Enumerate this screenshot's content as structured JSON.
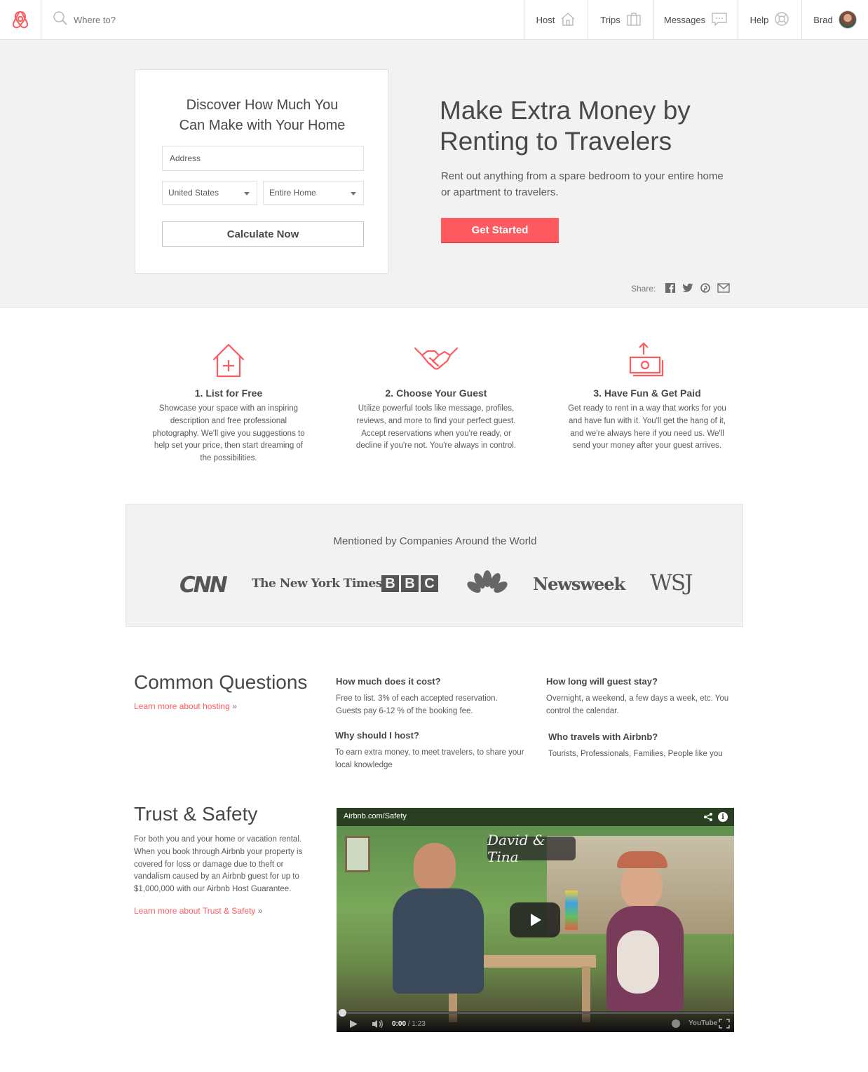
{
  "header": {
    "search_placeholder": "Where to?",
    "nav": [
      {
        "label": "Host",
        "icon": "house-icon"
      },
      {
        "label": "Trips",
        "icon": "suitcase-icon"
      },
      {
        "label": "Messages",
        "icon": "chat-bubble-icon"
      },
      {
        "label": "Help",
        "icon": "lifebuoy-icon"
      },
      {
        "label": "Brad",
        "icon": "avatar"
      }
    ]
  },
  "calculator": {
    "title_line1": "Discover How Much You",
    "title_line2": "Can Make with Your Home",
    "address_placeholder": "Address",
    "country_selected": "United States",
    "room_type_selected": "Entire Home",
    "button_label": "Calculate Now"
  },
  "hero": {
    "title_line1": "Make Extra Money by",
    "title_line2": "Renting to Travelers",
    "subtitle": "Rent out anything from a spare bedroom to your entire home or apartment to travelers.",
    "cta_label": "Get Started",
    "share_label": "Share:"
  },
  "steps": [
    {
      "title": "1. List for Free",
      "body": "Showcase your space with an inspiring description and free professional photography. We'll give you suggestions to help set your price, then start dreaming of the possibilities.",
      "icon": "house-plus-icon"
    },
    {
      "title": "2. Choose Your Guest",
      "body": "Utilize powerful tools like message, profiles, reviews, and more to find your perfect guest. Accept reservations when you're ready, or decline if you're not. You're always in control.",
      "icon": "handshake-icon"
    },
    {
      "title": "3. Have Fun & Get Paid",
      "body": "Get ready to rent in a way that works for you and have fun with it. You'll get the hang of it, and we're always here if you need us. We'll send your money after your guest arrives.",
      "icon": "money-upload-icon"
    }
  ],
  "press": {
    "title": "Mentioned by Companies Around the World",
    "logos": [
      "CNN",
      "The New York Times",
      "BBC",
      "NBC",
      "Newsweek",
      "WSJ"
    ]
  },
  "questions": {
    "title": "Common Questions",
    "learn_more": "Learn more about hosting",
    "learn_more_suffix": "»",
    "items": [
      {
        "q": "How much does it cost?",
        "a": "Free to list. 3% of each accepted reservation. Guests pay 6-12 % of the booking fee."
      },
      {
        "q": "How long will guest stay?",
        "a": "Overnight, a weekend, a few days a week, etc. You control the calendar."
      },
      {
        "q": "Why should I host?",
        "a": "To earn extra money, to meet travelers, to share your local knowledge"
      },
      {
        "q": "Who travels with Airbnb?",
        "a": "Tourists, Professionals, Families, People like you"
      }
    ]
  },
  "trust": {
    "title": "Trust & Safety",
    "body": "For both you and your home or vacation rental. When you book through Airbnb your property is covered for loss or damage due to theft or vandalism caused by an Airbnb guest for up to $1,000,000 with our Airbnb Host Guarantee.",
    "learn_more": "Learn more about Trust & Safety",
    "learn_more_suffix": "»"
  },
  "video": {
    "title": "Airbnb.com/Safety",
    "caption": "David & Tina",
    "time_current": "0:00",
    "time_total": "/ 1:23",
    "brand": "YouTube"
  },
  "colors": {
    "brand": "#ff5a5f",
    "text": "#484848",
    "hero_bg": "#f2f2f2"
  }
}
